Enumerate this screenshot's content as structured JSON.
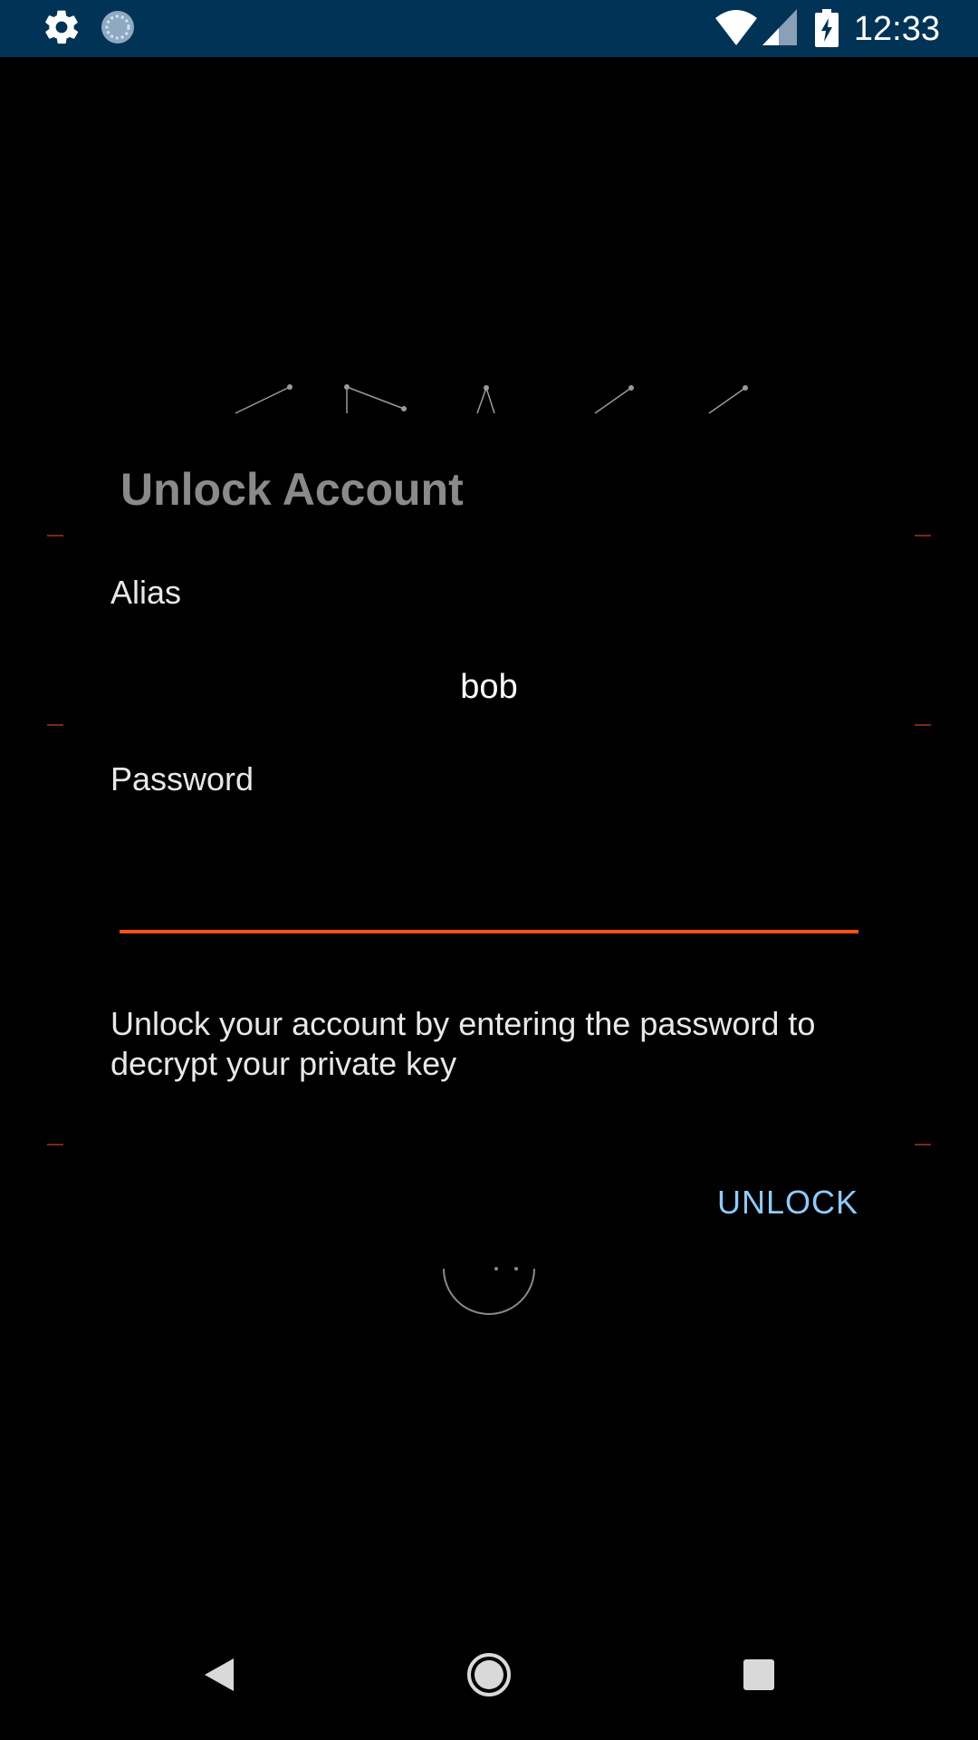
{
  "status_bar": {
    "time": "12:33",
    "background_color": "#003355",
    "icons": [
      "settings-icon",
      "sync-icon",
      "wifi-icon",
      "cellular-signal-icon",
      "battery-charging-icon"
    ]
  },
  "dialog": {
    "title": "Unlock Account",
    "alias_label": "Alias",
    "alias_value": "bob",
    "password_label": "Password",
    "password_value": "",
    "help_text": "Unlock your account by entering the password to decrypt your private key",
    "unlock_button": "UNLOCK"
  },
  "colors": {
    "accent_underline": "#f4511e",
    "button_text": "#90caf9",
    "title_text": "#8a8a8a"
  },
  "nav_bar": {
    "icons": [
      "back-icon",
      "home-icon",
      "recents-icon"
    ]
  }
}
